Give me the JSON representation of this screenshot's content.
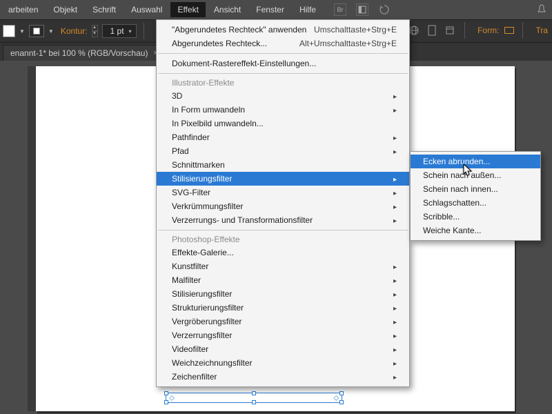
{
  "menubar": {
    "items": [
      {
        "label": "arbeiten"
      },
      {
        "label": "Objekt"
      },
      {
        "label": "Schrift"
      },
      {
        "label": "Auswahl"
      },
      {
        "label": "Effekt",
        "active": true
      },
      {
        "label": "Ansicht"
      },
      {
        "label": "Fenster"
      },
      {
        "label": "Hilfe"
      }
    ]
  },
  "toolbar": {
    "kontur_label": "Kontur:",
    "stroke_value": "1 pt",
    "form_label": "Form:",
    "tra_label": "Tra"
  },
  "document_tab": {
    "title": "enannt-1* bei 100 % (RGB/Vorschau)"
  },
  "effect_menu": {
    "apply_last": {
      "label": "\"Abgerundetes Rechteck\" anwenden",
      "shortcut": "Umschalttaste+Strg+E"
    },
    "last_effect": {
      "label": "Abgerundetes Rechteck...",
      "shortcut": "Alt+Umschalttaste+Strg+E"
    },
    "raster_settings": {
      "label": "Dokument-Rastereffekt-Einstellungen..."
    },
    "illustrator_header": "Illustrator-Effekte",
    "illustrator_items": [
      {
        "label": "3D",
        "submenu": true
      },
      {
        "label": "In Form umwandeln",
        "submenu": true
      },
      {
        "label": "In Pixelbild umwandeln..."
      },
      {
        "label": "Pathfinder",
        "submenu": true
      },
      {
        "label": "Pfad",
        "submenu": true
      },
      {
        "label": "Schnittmarken"
      },
      {
        "label": "Stilisierungsfilter",
        "submenu": true,
        "highlighted": true
      },
      {
        "label": "SVG-Filter",
        "submenu": true
      },
      {
        "label": "Verkrümmungsfilter",
        "submenu": true
      },
      {
        "label": "Verzerrungs- und Transformationsfilter",
        "submenu": true
      }
    ],
    "photoshop_header": "Photoshop-Effekte",
    "photoshop_items": [
      {
        "label": "Effekte-Galerie..."
      },
      {
        "label": "Kunstfilter",
        "submenu": true
      },
      {
        "label": "Malfilter",
        "submenu": true
      },
      {
        "label": "Stilisierungsfilter",
        "submenu": true
      },
      {
        "label": "Strukturierungsfilter",
        "submenu": true
      },
      {
        "label": "Vergröberungsfilter",
        "submenu": true
      },
      {
        "label": "Verzerrungsfilter",
        "submenu": true
      },
      {
        "label": "Videofilter",
        "submenu": true
      },
      {
        "label": "Weichzeichnungsfilter",
        "submenu": true
      },
      {
        "label": "Zeichenfilter",
        "submenu": true
      }
    ]
  },
  "stylize_submenu": {
    "items": [
      {
        "label": "Ecken abrunden...",
        "highlighted": true
      },
      {
        "label": "Schein nach außen..."
      },
      {
        "label": "Schein nach innen..."
      },
      {
        "label": "Schlagschatten..."
      },
      {
        "label": "Scribble..."
      },
      {
        "label": "Weiche Kante..."
      }
    ]
  }
}
